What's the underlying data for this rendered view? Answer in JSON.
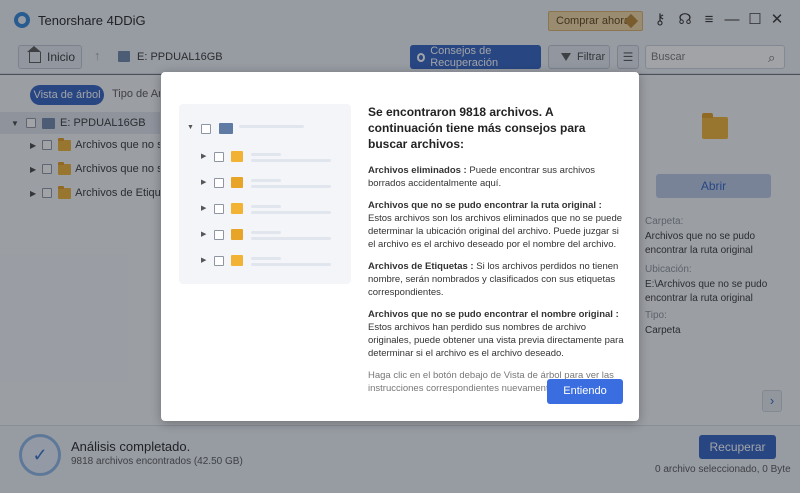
{
  "app": {
    "title": "Tenorshare 4DDiG",
    "buy_label": "Comprar ahora"
  },
  "toolbar": {
    "home_label": "Inicio",
    "drive_label": "E: PPDUAL16GB",
    "tips_label": "Consejos de Recuperación",
    "filter_label": "Filtrar",
    "search_placeholder": "Buscar"
  },
  "left_panel": {
    "tab_tree": "Vista de árbol",
    "tab_type": "Tipo de Arc",
    "root_label": "E: PPDUAL16GB",
    "items": [
      {
        "label": "Archivos que no se"
      },
      {
        "label": "Archivos que no se"
      },
      {
        "label": "Archivos de Etiquet"
      }
    ]
  },
  "right_panel": {
    "open_label": "Abrir",
    "folder_label": "Carpeta:",
    "folder_value": "Archivos que no se pudo encontrar la ruta original",
    "location_label": "Ubicación:",
    "location_value": "E:\\Archivos que no se pudo encontrar la ruta original",
    "type_label": "Tipo:",
    "type_value": "Carpeta"
  },
  "bottom": {
    "status_title": "Análisis completado.",
    "status_sub": "9818 archivos encontrados (42.50 GB)",
    "recover_label": "Recuperar",
    "selected_info": "0 archivo seleccionado, 0 Byte"
  },
  "dialog": {
    "title": "Se encontraron 9818 archivos. A continuación tiene más consejos para buscar archivos:",
    "tips": [
      {
        "head": "Archivos eliminados :",
        "body": " Puede encontrar sus archivos borrados accidentalmente aquí."
      },
      {
        "head": "Archivos que no se pudo encontrar la ruta original :",
        "body": " Estos archivos son los archivos eliminados que no se puede determinar la ubicación original del archivo. Puede juzgar si el archivo es el archivo deseado por el nombre del archivo."
      },
      {
        "head": "Archivos de Etiquetas :",
        "body": " Si los archivos perdidos no tienen nombre, serán nombrados y clasificados con sus etiquetas correspondientes."
      },
      {
        "head": "Archivos que no se pudo encontrar el nombre original :",
        "body": " Estos archivos han perdido sus nombres de archivo originales, puede obtener una vista previa directamente para determinar si el archivo es el archivo deseado."
      }
    ],
    "note": "Haga clic en el botón debajo de Vista de árbol para ver las instrucciones correspondientes nuevamente.",
    "ok_label": "Entiendo"
  }
}
